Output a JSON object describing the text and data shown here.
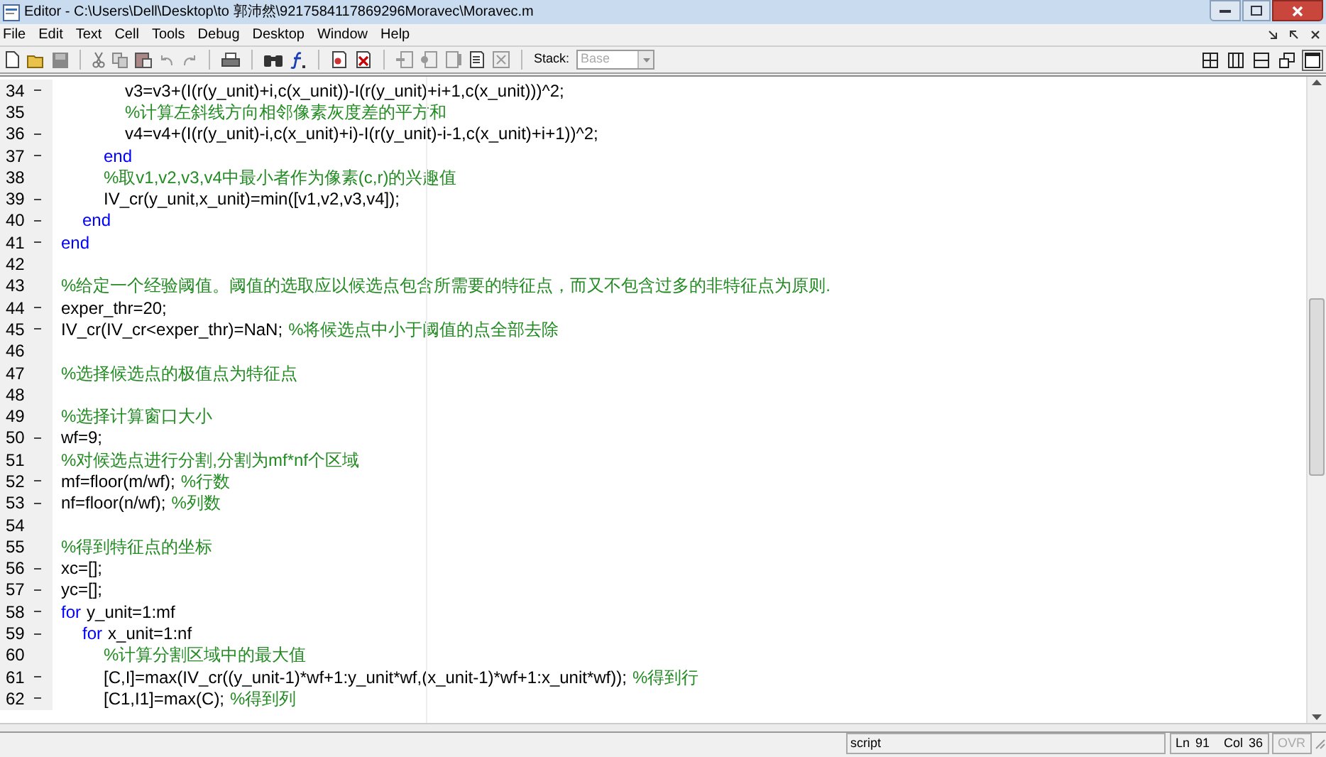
{
  "window": {
    "title": "Editor - C:\\Users\\Dell\\Desktop\\to 郭沛然\\9217584117869296Moravec\\Moravec.m"
  },
  "menu": [
    "File",
    "Edit",
    "Text",
    "Cell",
    "Tools",
    "Debug",
    "Desktop",
    "Window",
    "Help"
  ],
  "toolbar": {
    "stack_label": "Stack:",
    "stack_value": "Base",
    "stack_disabled": true,
    "layouts": [
      {
        "kind": "tile",
        "selected": false
      },
      {
        "kind": "columns",
        "selected": false
      },
      {
        "kind": "rows",
        "selected": false
      },
      {
        "kind": "float",
        "selected": false
      },
      {
        "kind": "maximize",
        "selected": true
      }
    ]
  },
  "editor": {
    "lines": [
      {
        "number": "34",
        "executable": true,
        "segments": [
          {
            "kind": "code",
            "text": "            v3=v3+(I(r(y_unit)+i,c(x_unit))-I(r(y_unit)+i+1,c(x_unit)))^2;"
          }
        ]
      },
      {
        "number": "35",
        "executable": false,
        "segments": [
          {
            "kind": "comment",
            "text": "            %计算左斜线方向相邻像素灰度差的平方和"
          }
        ]
      },
      {
        "number": "36",
        "executable": true,
        "segments": [
          {
            "kind": "code",
            "text": "            v4=v4+(I(r(y_unit)-i,c(x_unit)+i)-I(r(y_unit)-i-1,c(x_unit)+i+1))^2;"
          }
        ]
      },
      {
        "number": "37",
        "executable": true,
        "segments": [
          {
            "kind": "keyword",
            "text": "        end"
          }
        ]
      },
      {
        "number": "38",
        "executable": false,
        "segments": [
          {
            "kind": "comment",
            "text": "        %取v1,v2,v3,v4中最小者作为像素(c,r)的兴趣值"
          }
        ]
      },
      {
        "number": "39",
        "executable": true,
        "segments": [
          {
            "kind": "code",
            "text": "        IV_cr(y_unit,x_unit)=min([v1,v2,v3,v4]);"
          }
        ]
      },
      {
        "number": "40",
        "executable": true,
        "segments": [
          {
            "kind": "keyword",
            "text": "    end"
          }
        ]
      },
      {
        "number": "41",
        "executable": true,
        "segments": [
          {
            "kind": "keyword",
            "text": "end"
          }
        ]
      },
      {
        "number": "42",
        "executable": false
      },
      {
        "number": "43",
        "executable": false,
        "segments": [
          {
            "kind": "comment",
            "text": "%给定一个经验阈值。阈值的选取应以候选点包含所需要的特征点，而又不包含过多的非特征点为原则."
          }
        ]
      },
      {
        "number": "44",
        "executable": true,
        "segments": [
          {
            "kind": "code",
            "text": "exper_thr=20;"
          }
        ]
      },
      {
        "number": "45",
        "executable": true,
        "segments": [
          {
            "kind": "code",
            "text": "IV_cr(IV_cr<exper_thr)=NaN;"
          },
          {
            "kind": "comment",
            "text": "%将候选点中小于阈值的点全部去除"
          }
        ]
      },
      {
        "number": "46",
        "executable": false
      },
      {
        "number": "47",
        "executable": false,
        "segments": [
          {
            "kind": "comment",
            "text": "%选择候选点的极值点为特征点"
          }
        ]
      },
      {
        "number": "48",
        "executable": false
      },
      {
        "number": "49",
        "executable": false,
        "segments": [
          {
            "kind": "comment",
            "text": "%选择计算窗口大小"
          }
        ]
      },
      {
        "number": "50",
        "executable": true,
        "segments": [
          {
            "kind": "code",
            "text": "wf=9;"
          }
        ]
      },
      {
        "number": "51",
        "executable": false,
        "segments": [
          {
            "kind": "comment",
            "text": "%对候选点进行分割,分割为mf*nf个区域"
          }
        ]
      },
      {
        "number": "52",
        "executable": true,
        "segments": [
          {
            "kind": "code",
            "text": "mf=floor(m/wf);"
          },
          {
            "kind": "comment",
            "text": "%行数"
          }
        ]
      },
      {
        "number": "53",
        "executable": true,
        "segments": [
          {
            "kind": "code",
            "text": "nf=floor(n/wf);"
          },
          {
            "kind": "comment",
            "text": "%列数"
          }
        ]
      },
      {
        "number": "54",
        "executable": false
      },
      {
        "number": "55",
        "executable": false,
        "segments": [
          {
            "kind": "comment",
            "text": "%得到特征点的坐标"
          }
        ]
      },
      {
        "number": "56",
        "executable": true,
        "segments": [
          {
            "kind": "code",
            "text": "xc=[];"
          }
        ]
      },
      {
        "number": "57",
        "executable": true,
        "segments": [
          {
            "kind": "code",
            "text": "yc=[];"
          }
        ]
      },
      {
        "number": "58",
        "executable": true,
        "segments": [
          {
            "kind": "keyword",
            "text": "for"
          },
          {
            "kind": "code",
            "text": "y_unit=1:mf"
          }
        ]
      },
      {
        "number": "59",
        "executable": true,
        "segments": [
          {
            "kind": "keyword",
            "text": "    for"
          },
          {
            "kind": "code",
            "text": "x_unit=1:nf"
          }
        ]
      },
      {
        "number": "60",
        "executable": false,
        "segments": [
          {
            "kind": "comment",
            "text": "        %计算分割区域中的最大值"
          }
        ]
      },
      {
        "number": "61",
        "executable": true,
        "segments": [
          {
            "kind": "code",
            "text": "        [C,I]=max(IV_cr((y_unit-1)*wf+1:y_unit*wf,(x_unit-1)*wf+1:x_unit*wf));"
          },
          {
            "kind": "comment",
            "text": "%得到行"
          }
        ]
      },
      {
        "number": "62",
        "executable": true,
        "segments": [
          {
            "kind": "code",
            "text": "        [C1,I1]=max(C);"
          },
          {
            "kind": "comment",
            "text": "%得到列"
          }
        ]
      }
    ]
  },
  "status_bar": {
    "mode": "script",
    "ln_label": "Ln",
    "ln": "91",
    "col_label": "Col",
    "col": "36",
    "ovr": "OVR",
    "ovr_active": false
  }
}
